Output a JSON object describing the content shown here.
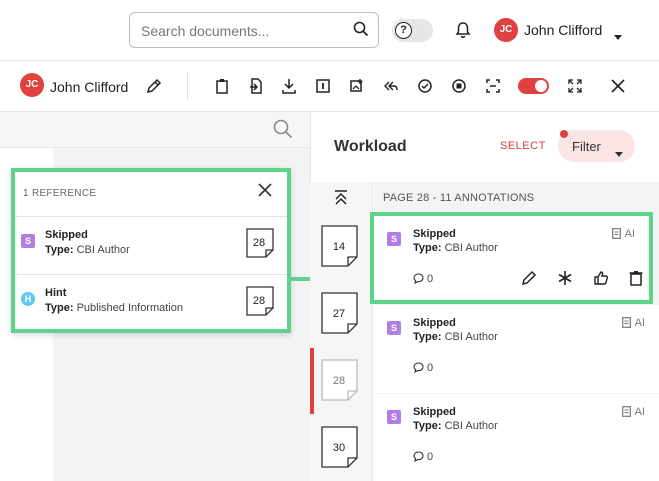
{
  "topbar": {
    "search_placeholder": "Search documents...",
    "help_icon_label": "?",
    "user": {
      "initials": "JC",
      "name": "John Clifford"
    }
  },
  "toolbar": {
    "user": {
      "initials": "JC",
      "name": "John Clifford"
    },
    "icons": [
      "clipboard-icon",
      "import-icon",
      "download-icon",
      "info-box-icon",
      "image-add-icon",
      "reply-all-icon",
      "check-circle-icon",
      "stop-circle-icon",
      "scan-icon",
      "toggle",
      "fullscreen-icon",
      "close-icon"
    ],
    "accent": "#e0403f"
  },
  "reference_popup": {
    "header": "1 REFERENCE",
    "items": [
      {
        "badge": "S",
        "title": "Skipped",
        "type_label": "Type:",
        "type_value": "CBI Author",
        "page": "28"
      },
      {
        "badge": "H",
        "title": "Hint",
        "type_label": "Type:",
        "type_value": "Published Information",
        "page": "28"
      }
    ]
  },
  "thumbnails": [
    "14",
    "27",
    "28",
    "30"
  ],
  "workload": {
    "title": "Workload",
    "select_label": "SELECT",
    "filter_label": "Filter",
    "page_header": "PAGE 28 - 11 ANNOTATIONS",
    "annotations": [
      {
        "badge": "S",
        "title": "Skipped",
        "type_label": "Type:",
        "type_value": "CBI Author",
        "source": "AI",
        "comments": "0"
      },
      {
        "badge": "S",
        "title": "Skipped",
        "type_label": "Type:",
        "type_value": "CBI Author",
        "source": "AI",
        "comments": "0"
      },
      {
        "badge": "S",
        "title": "Skipped",
        "type_label": "Type:",
        "type_value": "CBI Author",
        "source": "AI",
        "comments": "0"
      }
    ]
  },
  "colors": {
    "highlight": "#5dd38c",
    "skipped_badge": "#b17fe3",
    "hint_badge": "#61c9ef",
    "accent": "#e0403f"
  }
}
